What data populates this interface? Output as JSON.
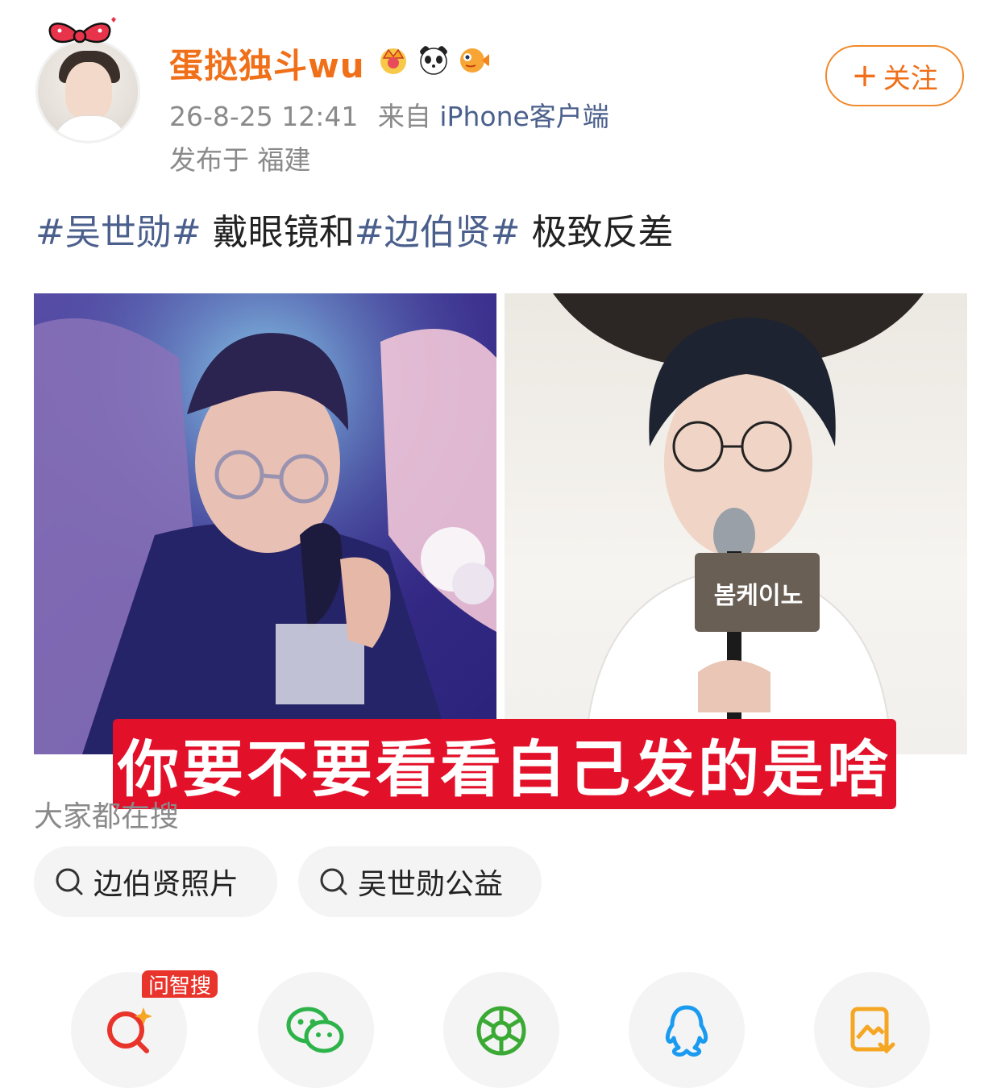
{
  "author": {
    "name": "蛋挞独斗wu",
    "badges": [
      "crown-badge-icon",
      "panda-badge-icon",
      "fish-badge-icon"
    ]
  },
  "post_meta": {
    "time": "26-8-25 12:41",
    "from_prefix": "来自",
    "device": "iPhone客户端",
    "location_label": "发布于 福建"
  },
  "follow_button": {
    "plus": "+",
    "label": "关注"
  },
  "post_text": {
    "tag1": "#吴世勋#",
    "text1": " 戴眼镜和",
    "tag2": "#边伯贤#",
    "text2": " 极致反差"
  },
  "images": [
    {
      "name": "photo-left",
      "sign_text": ""
    },
    {
      "name": "photo-right",
      "sign_text": "봄케이노"
    }
  ],
  "caption": "你要不要看看自己发的是啥",
  "search": {
    "title": "大家都在搜",
    "chips": [
      "边伯贤照片",
      "吴世勋公益"
    ]
  },
  "share_bar": {
    "badge": "问智搜",
    "items": [
      "smart-search-icon",
      "wechat-icon",
      "moments-icon",
      "qq-icon",
      "save-image-icon"
    ]
  },
  "colors": {
    "username": "#f06f19",
    "link": "#4a5f8c",
    "caption_bg": "#e3102a",
    "meta": "#8a8a8a"
  }
}
